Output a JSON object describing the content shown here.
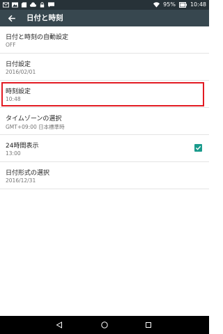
{
  "status_bar": {
    "battery_percent": "95%",
    "time": "10:48",
    "left_icons": [
      "mail-icon",
      "image-icon",
      "sd-card-icon",
      "cloud-icon",
      "lock-icon",
      "chat-icon"
    ]
  },
  "app_bar": {
    "title": "日付と時刻",
    "back_icon": "arrow-back-icon"
  },
  "settings": [
    {
      "title": "日付と時刻の自動設定",
      "summary": "OFF"
    },
    {
      "title": "日付設定",
      "summary": "2016/02/01"
    },
    {
      "title": "時刻設定",
      "summary": "10:48",
      "highlighted": true
    },
    {
      "title": "タイムゾーンの選択",
      "summary": "GMT+09:00 日本標準時"
    },
    {
      "title": "24時間表示",
      "summary": "13:00",
      "checked": true
    },
    {
      "title": "日付形式の選択",
      "summary": "2016/12/31"
    }
  ],
  "colors": {
    "status_bar": "#273238",
    "app_bar": "#37474f",
    "highlight": "#e21a22",
    "checkbox": "#1a9b8c"
  },
  "nav_bar": {
    "buttons": [
      "back-triangle-icon",
      "home-circle-icon",
      "recents-square-icon"
    ]
  }
}
